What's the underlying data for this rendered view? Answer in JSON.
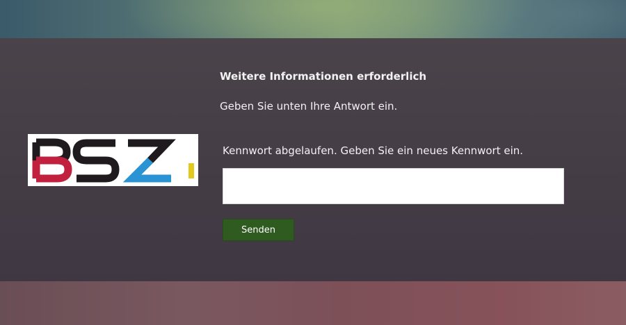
{
  "form": {
    "title": "Weitere Informationen erforderlich",
    "subtitle": "Geben Sie unten Ihre Antwort ein.",
    "field_label": "Kennwort abgelaufen. Geben Sie ein neues Kennwort ein.",
    "input_value": "",
    "input_placeholder": "",
    "submit_label": "Senden"
  },
  "logo": {
    "text": "BSZ",
    "icon": "bsz-logo",
    "colors": {
      "dark": "#1f1a1d",
      "red": "#c2203f",
      "blue": "#2a93d3",
      "yellow": "#e4c81c"
    }
  },
  "theme": {
    "panel": "#443c45",
    "button": "#2f5a20",
    "text": "#f2f2f2"
  }
}
